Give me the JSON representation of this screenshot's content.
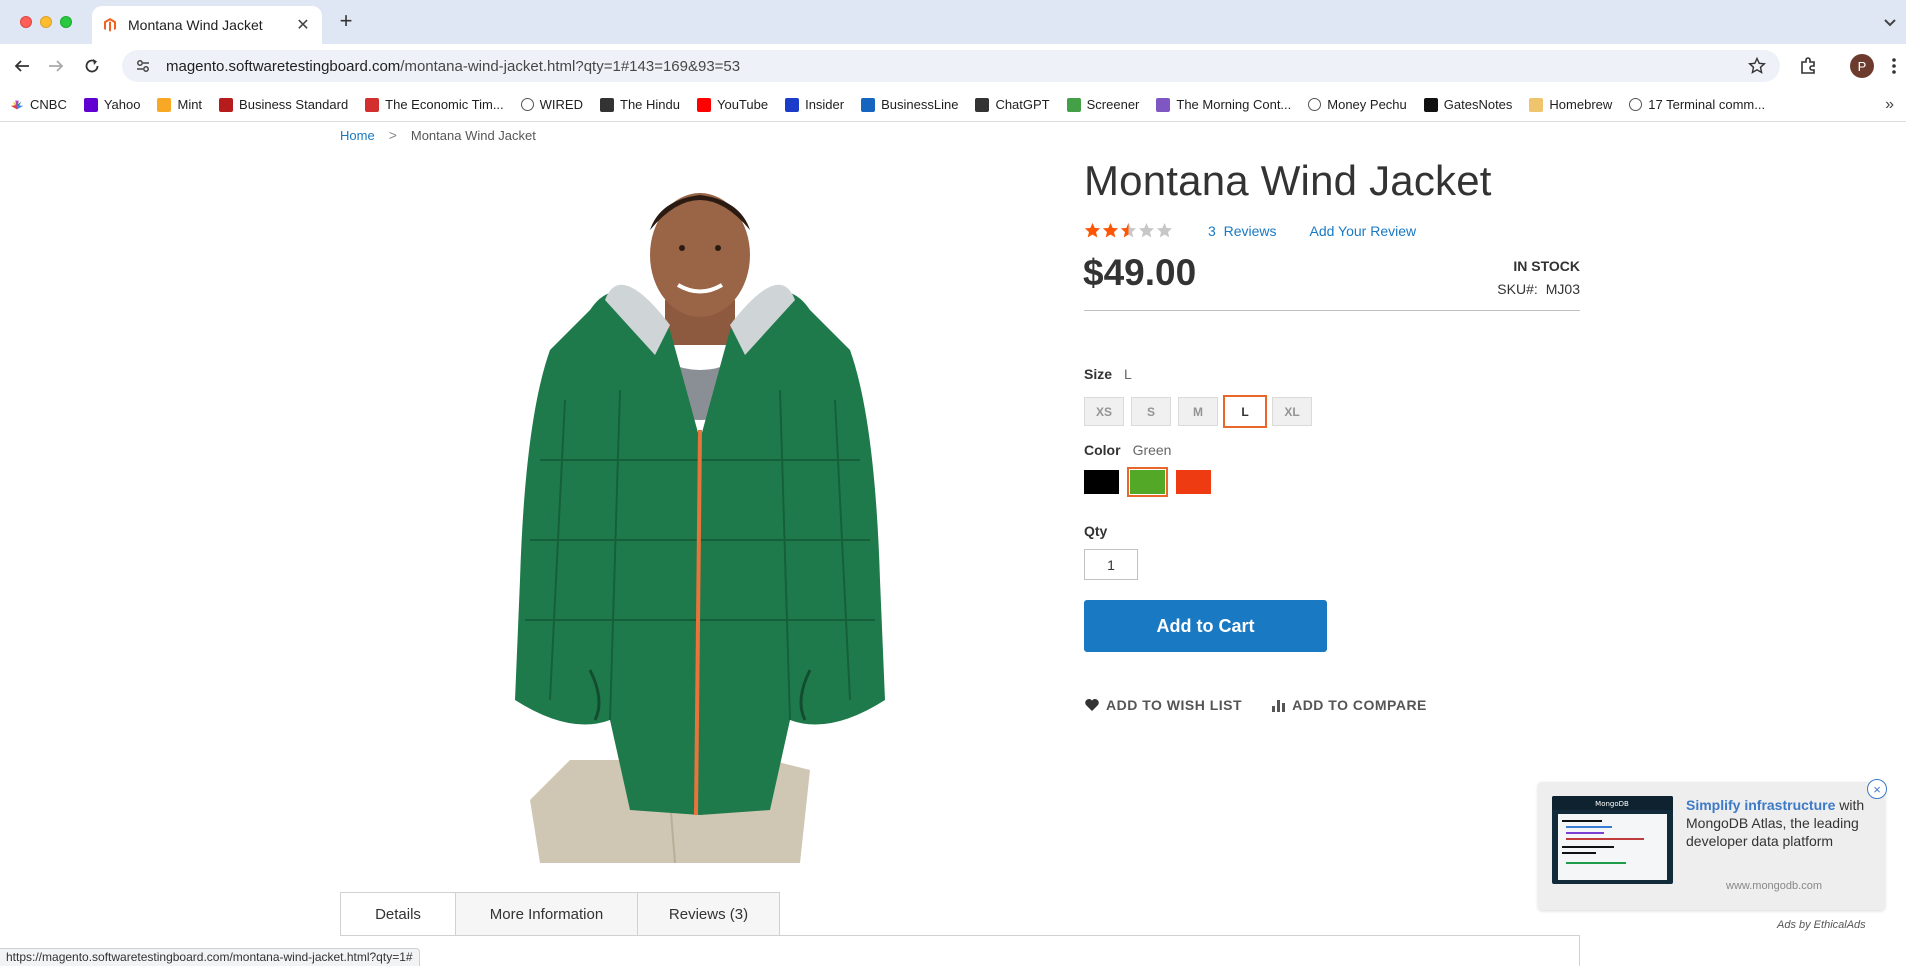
{
  "browser": {
    "tab_title": "Montana Wind Jacket",
    "new_tab_symbol": "+",
    "url_host": "magento.softwaretestingboard.com",
    "url_path": "/montana-wind-jacket.html?qty=1#143=169&93=53",
    "profile_initial": "P",
    "status_url": "https://magento.softwaretestingboard.com/montana-wind-jacket.html?qty=1#",
    "bookmarks": [
      {
        "label": "CNBC",
        "icon": "cnbc-icon",
        "color": "#ffffff"
      },
      {
        "label": "Yahoo",
        "icon": "yahoo-icon",
        "color": "#6001d2"
      },
      {
        "label": "Mint",
        "icon": "mint-icon",
        "color": "#f9a825"
      },
      {
        "label": "Business Standard",
        "icon": "business-standard-icon",
        "color": "#b71c1c"
      },
      {
        "label": "The Economic Tim...",
        "icon": "economic-times-icon",
        "color": "#d32f2f"
      },
      {
        "label": "WIRED",
        "icon": "globe-icon",
        "color": "#555555"
      },
      {
        "label": "The Hindu",
        "icon": "the-hindu-icon",
        "color": "#333333"
      },
      {
        "label": "YouTube",
        "icon": "youtube-icon",
        "color": "#ff0000"
      },
      {
        "label": "Insider",
        "icon": "insider-icon",
        "color": "#1a3cc9"
      },
      {
        "label": "BusinessLine",
        "icon": "businessline-icon",
        "color": "#1565c0"
      },
      {
        "label": "ChatGPT",
        "icon": "chatgpt-icon",
        "color": "#333333"
      },
      {
        "label": "Screener",
        "icon": "screener-icon",
        "color": "#43a047"
      },
      {
        "label": "The Morning Cont...",
        "icon": "morning-context-icon",
        "color": "#7e57c2"
      },
      {
        "label": "Money Pechu",
        "icon": "globe-icon",
        "color": "#555555"
      },
      {
        "label": "GatesNotes",
        "icon": "gatesnotes-icon",
        "color": "#111111"
      },
      {
        "label": "Homebrew",
        "icon": "homebrew-icon",
        "color": "#f0c36d"
      },
      {
        "label": "17 Terminal comm...",
        "icon": "globe-icon",
        "color": "#555555"
      }
    ]
  },
  "breadcrumb": {
    "home": "Home",
    "separator": ">",
    "current": "Montana Wind Jacket"
  },
  "product": {
    "name": "Montana Wind Jacket",
    "rating_fraction": 0.5,
    "reviews_count": "3",
    "reviews_label": "Reviews",
    "add_review": "Add Your Review",
    "price": "$49.00",
    "stock": "IN STOCK",
    "sku_label": "SKU#:",
    "sku": "MJ03",
    "image_alt": "Montana Wind Jacket"
  },
  "options": {
    "size_label": "Size",
    "size_selected": "L",
    "sizes": [
      "XS",
      "S",
      "M",
      "L",
      "XL"
    ],
    "color_label": "Color",
    "color_selected": "Green",
    "colors": [
      {
        "name": "Black",
        "hex": "#000000"
      },
      {
        "name": "Green",
        "hex": "#53a828"
      },
      {
        "name": "Red",
        "hex": "#ef3b12"
      }
    ]
  },
  "purchase": {
    "qty_label": "Qty",
    "qty_value": "1",
    "add_to_cart": "Add to Cart",
    "wish_list": "ADD TO WISH LIST",
    "compare": "ADD TO COMPARE"
  },
  "tabs": [
    {
      "label": "Details",
      "active": true
    },
    {
      "label": "More Information",
      "active": false
    },
    {
      "label": "Reviews (3)",
      "active": false
    }
  ],
  "ad": {
    "headline": "Simplify infrastructure",
    "body": " with MongoDB Atlas, the leading developer data platform",
    "domain": "www.mongodb.com",
    "image_logo": "MongoDB",
    "credit": "Ads by EthicalAds",
    "close_symbol": "×"
  },
  "colors": {
    "accent_blue": "#1979c3",
    "selected_orange": "#e8672b",
    "star_orange": "#ff5501"
  }
}
